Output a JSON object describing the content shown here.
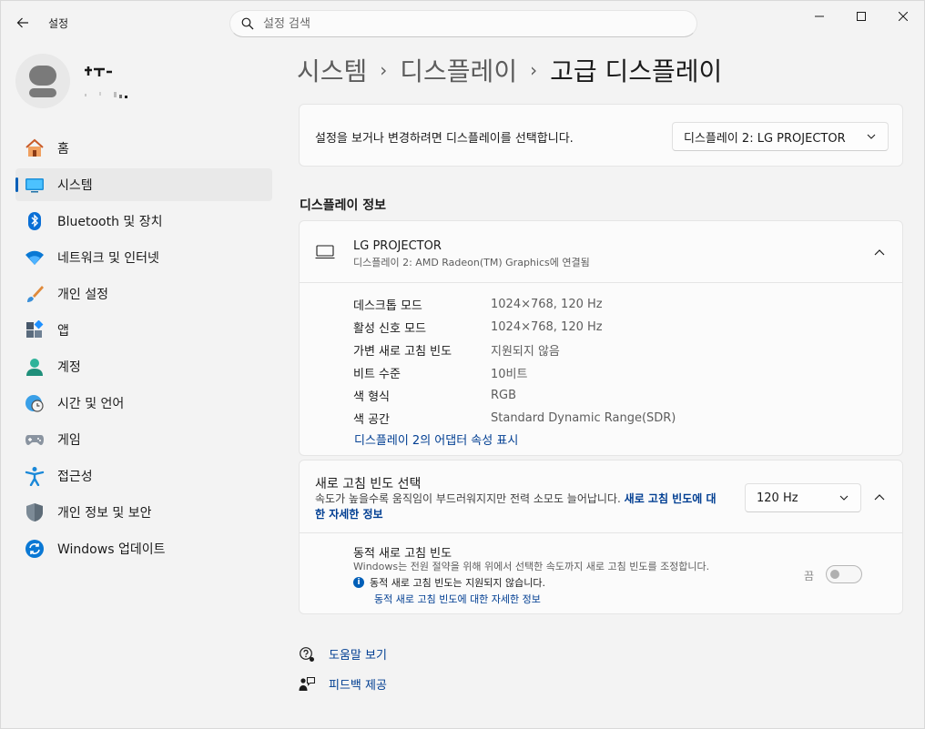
{
  "app": {
    "title": "설정",
    "search_placeholder": "설정 검색"
  },
  "profile": {
    "name": "",
    "email": ""
  },
  "sidebar": {
    "items": [
      {
        "label": "홈",
        "icon": "home-icon"
      },
      {
        "label": "시스템",
        "icon": "system-icon",
        "active": true
      },
      {
        "label": "Bluetooth 및 장치",
        "icon": "bluetooth-icon"
      },
      {
        "label": "네트워크 및 인터넷",
        "icon": "wifi-icon"
      },
      {
        "label": "개인 설정",
        "icon": "brush-icon"
      },
      {
        "label": "앱",
        "icon": "apps-icon"
      },
      {
        "label": "계정",
        "icon": "account-icon"
      },
      {
        "label": "시간 및 언어",
        "icon": "time-language-icon"
      },
      {
        "label": "게임",
        "icon": "gamepad-icon"
      },
      {
        "label": "접근성",
        "icon": "accessibility-icon"
      },
      {
        "label": "개인 정보 및 보안",
        "icon": "shield-icon"
      },
      {
        "label": "Windows 업데이트",
        "icon": "update-icon"
      }
    ]
  },
  "breadcrumb": {
    "level1": "시스템",
    "level2": "디스플레이",
    "current": "고급 디스플레이",
    "separator": "›"
  },
  "display_select": {
    "label": "설정을 보거나 변경하려면 디스플레이를 선택합니다.",
    "value": "디스플레이 2: LG PROJECTOR"
  },
  "display_info": {
    "section_title": "디스플레이 정보",
    "name": "LG PROJECTOR",
    "subtitle": "디스플레이 2: AMD Radeon(TM) Graphics에 연결됨",
    "properties": [
      {
        "key": "데스크톱 모드",
        "value": "1024×768, 120 Hz"
      },
      {
        "key": "활성 신호 모드",
        "value": "1024×768, 120 Hz"
      },
      {
        "key": "가변 새로 고침 빈도",
        "value": "지원되지 않음"
      },
      {
        "key": "비트 수준",
        "value": "10비트"
      },
      {
        "key": "색 형식",
        "value": "RGB"
      },
      {
        "key": "색 공간",
        "value": "Standard Dynamic Range(SDR)"
      }
    ],
    "adapter_link": "디스플레이 2의 어댑터 속성 표시"
  },
  "refresh": {
    "title": "새로 고침 빈도 선택",
    "desc": "속도가 높을수록 움직임이 부드러워지지만 전력 소모도 늘어납니다.",
    "desc_link": "새로 고침 빈도에 대한 자세한 정보",
    "value": "120 Hz",
    "dynamic": {
      "title": "동적 새로 고침 빈도",
      "desc": "Windows는 전원 절약을 위해 위에서 선택한 속도까지 새로 고침 빈도를 조정합니다.",
      "note": "동적 새로 고침 빈도는 지원되지 않습니다.",
      "note_link": "동적 새로 고침 빈도에 대한 자세한 정보",
      "toggle_state": "끔",
      "toggle_on": false
    }
  },
  "footer": {
    "help": "도움말 보기",
    "feedback": "피드백 제공"
  },
  "colors": {
    "accent": "#005fb8",
    "link": "#003e92"
  }
}
